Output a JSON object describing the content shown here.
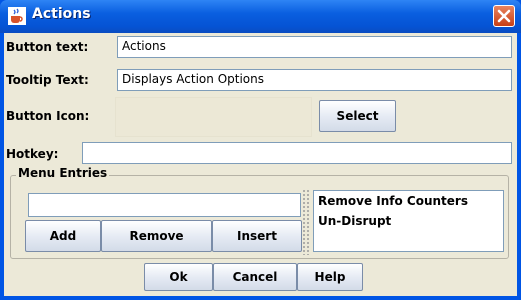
{
  "window": {
    "title": "Actions"
  },
  "fields": {
    "button_text": {
      "label": "Button text:",
      "value": "Actions"
    },
    "tooltip_text": {
      "label": "Tooltip Text:",
      "value": "Displays Action Options"
    },
    "button_icon": {
      "label": "Button Icon:",
      "select_label": "Select"
    },
    "hotkey": {
      "label": "Hotkey:",
      "value": ""
    }
  },
  "menu_entries": {
    "title": "Menu Entries",
    "entry_value": "",
    "add_label": "Add",
    "remove_label": "Remove",
    "insert_label": "Insert",
    "items": [
      "Remove Info Counters",
      "Un-Disrupt"
    ]
  },
  "footer": {
    "ok_label": "Ok",
    "cancel_label": "Cancel",
    "help_label": "Help"
  },
  "colors": {
    "title_bar": "#0a5fe0",
    "close_button": "#d9532b",
    "dialog_bg": "#ece9d8",
    "icon_preview": "#ece8d6"
  }
}
